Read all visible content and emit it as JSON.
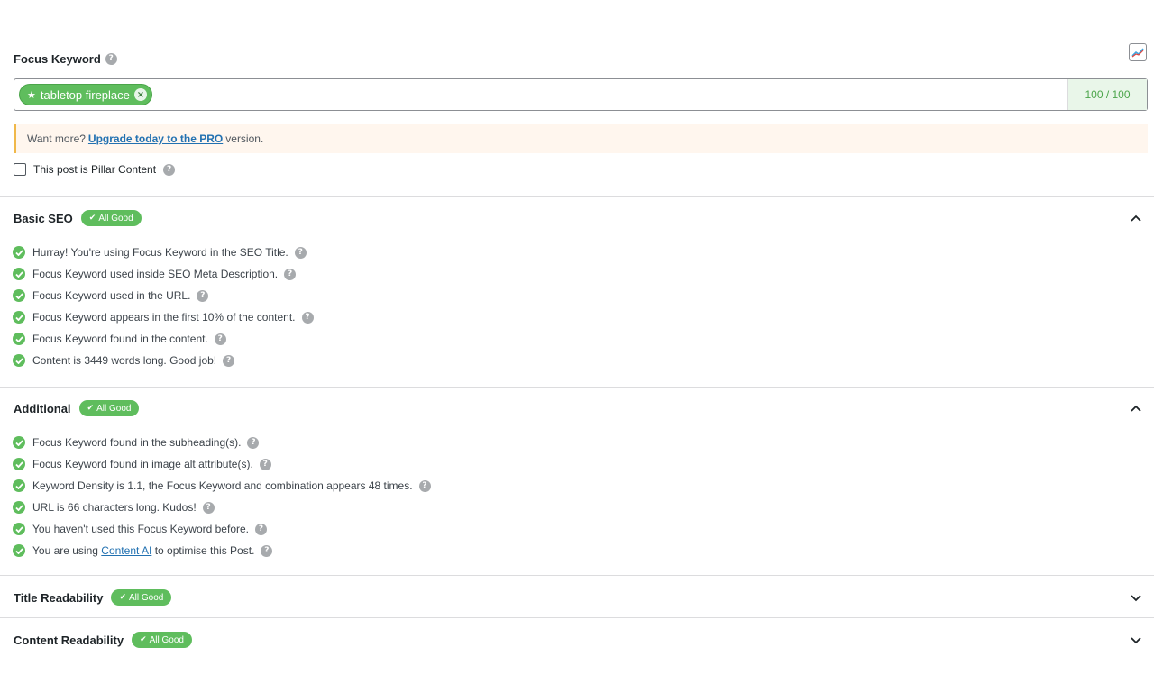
{
  "focus_keyword": {
    "label": "Focus Keyword",
    "keyword": "tabletop fireplace",
    "score": "100 / 100"
  },
  "notice": {
    "prefix": "Want more?",
    "link": "Upgrade today to the PRO",
    "suffix": "version."
  },
  "pillar": {
    "label": "This post is Pillar Content",
    "checked": false
  },
  "badge_text": "All Good",
  "sections": {
    "basic_seo": {
      "title": "Basic SEO",
      "items": [
        "Hurray! You're using Focus Keyword in the SEO Title.",
        "Focus Keyword used inside SEO Meta Description.",
        "Focus Keyword used in the URL.",
        "Focus Keyword appears in the first 10% of the content.",
        "Focus Keyword found in the content.",
        "Content is 3449 words long. Good job!"
      ]
    },
    "additional": {
      "title": "Additional",
      "items": [
        "Focus Keyword found in the subheading(s).",
        "Focus Keyword found in image alt attribute(s).",
        "Keyword Density is 1.1, the Focus Keyword and combination appears 48 times.",
        "URL is 66 characters long. Kudos!",
        "You haven't used this Focus Keyword before."
      ],
      "last_item": {
        "prefix": "You are using",
        "link": "Content AI",
        "suffix": "to optimise this Post."
      }
    },
    "title_readability": {
      "title": "Title Readability"
    },
    "content_readability": {
      "title": "Content Readability"
    }
  },
  "colors": {
    "success": "#5fbd5d",
    "link": "#2271b1",
    "notice_border": "#f0b849"
  }
}
